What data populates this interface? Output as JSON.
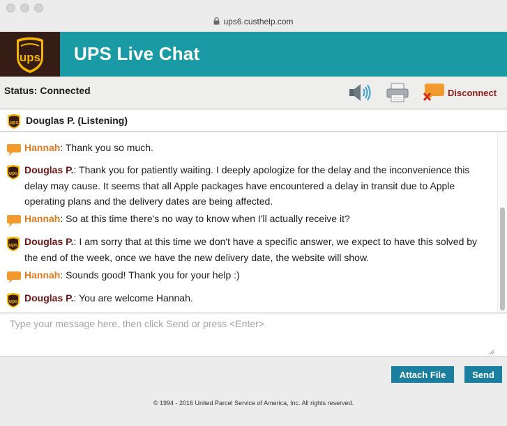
{
  "window": {
    "url": "ups6.custhelp.com"
  },
  "header": {
    "logo_text": "ups",
    "title": "UPS Live Chat"
  },
  "status": {
    "text": "Status: Connected",
    "disconnect_label": "Disconnect"
  },
  "agent": {
    "listening_label": "Douglas P. (Listening)"
  },
  "transcript": [
    {
      "sender": "Hannah",
      "role": "customer",
      "text": ": Thank you so much."
    },
    {
      "sender": "Douglas P.",
      "role": "agent",
      "text": ": Thank you for patiently waiting. I deeply apologize for the delay and the inconvenience this delay may cause. It seems that all Apple packages have encountered a delay in transit due to Apple operating plans and the delivery dates are being affected."
    },
    {
      "sender": "Hannah",
      "role": "customer",
      "text": ": So at this time there's no way to know when I'll actually receive it?"
    },
    {
      "sender": "Douglas P.",
      "role": "agent",
      "text": ": I am sorry that at this time we don't have a specific answer, we expect to have this solved by the end of the week, once we have the new delivery date, the website will show."
    },
    {
      "sender": "Hannah",
      "role": "customer",
      "text": ": Sounds good! Thank you for your help :)"
    },
    {
      "sender": "Douglas P.",
      "role": "agent",
      "text": ": You are welcome Hannah."
    }
  ],
  "input": {
    "placeholder": "Type your message here, then click Send or press <Enter>",
    "value": ""
  },
  "buttons": {
    "attach_label": "Attach File",
    "send_label": "Send"
  },
  "footer": {
    "copyright": "© 1994 - 2016 United Parcel Service of America, Inc. All rights reserved."
  },
  "colors": {
    "header_teal": "#1a9aa5",
    "ups_brown": "#351c15",
    "ups_gold": "#f7b500",
    "customer_name": "#e07a1d",
    "agent_name": "#6b1414",
    "button_blue": "#1b7fa0",
    "disconnect_red": "#8e1b14"
  },
  "icons": {
    "lock": "lock-icon",
    "logo": "ups-shield-logo",
    "sound": "speaker-icon",
    "print": "printer-icon",
    "disconnect": "chat-bubble-x-icon",
    "customer": "chat-bubble-icon",
    "agent": "ups-shield-icon"
  }
}
